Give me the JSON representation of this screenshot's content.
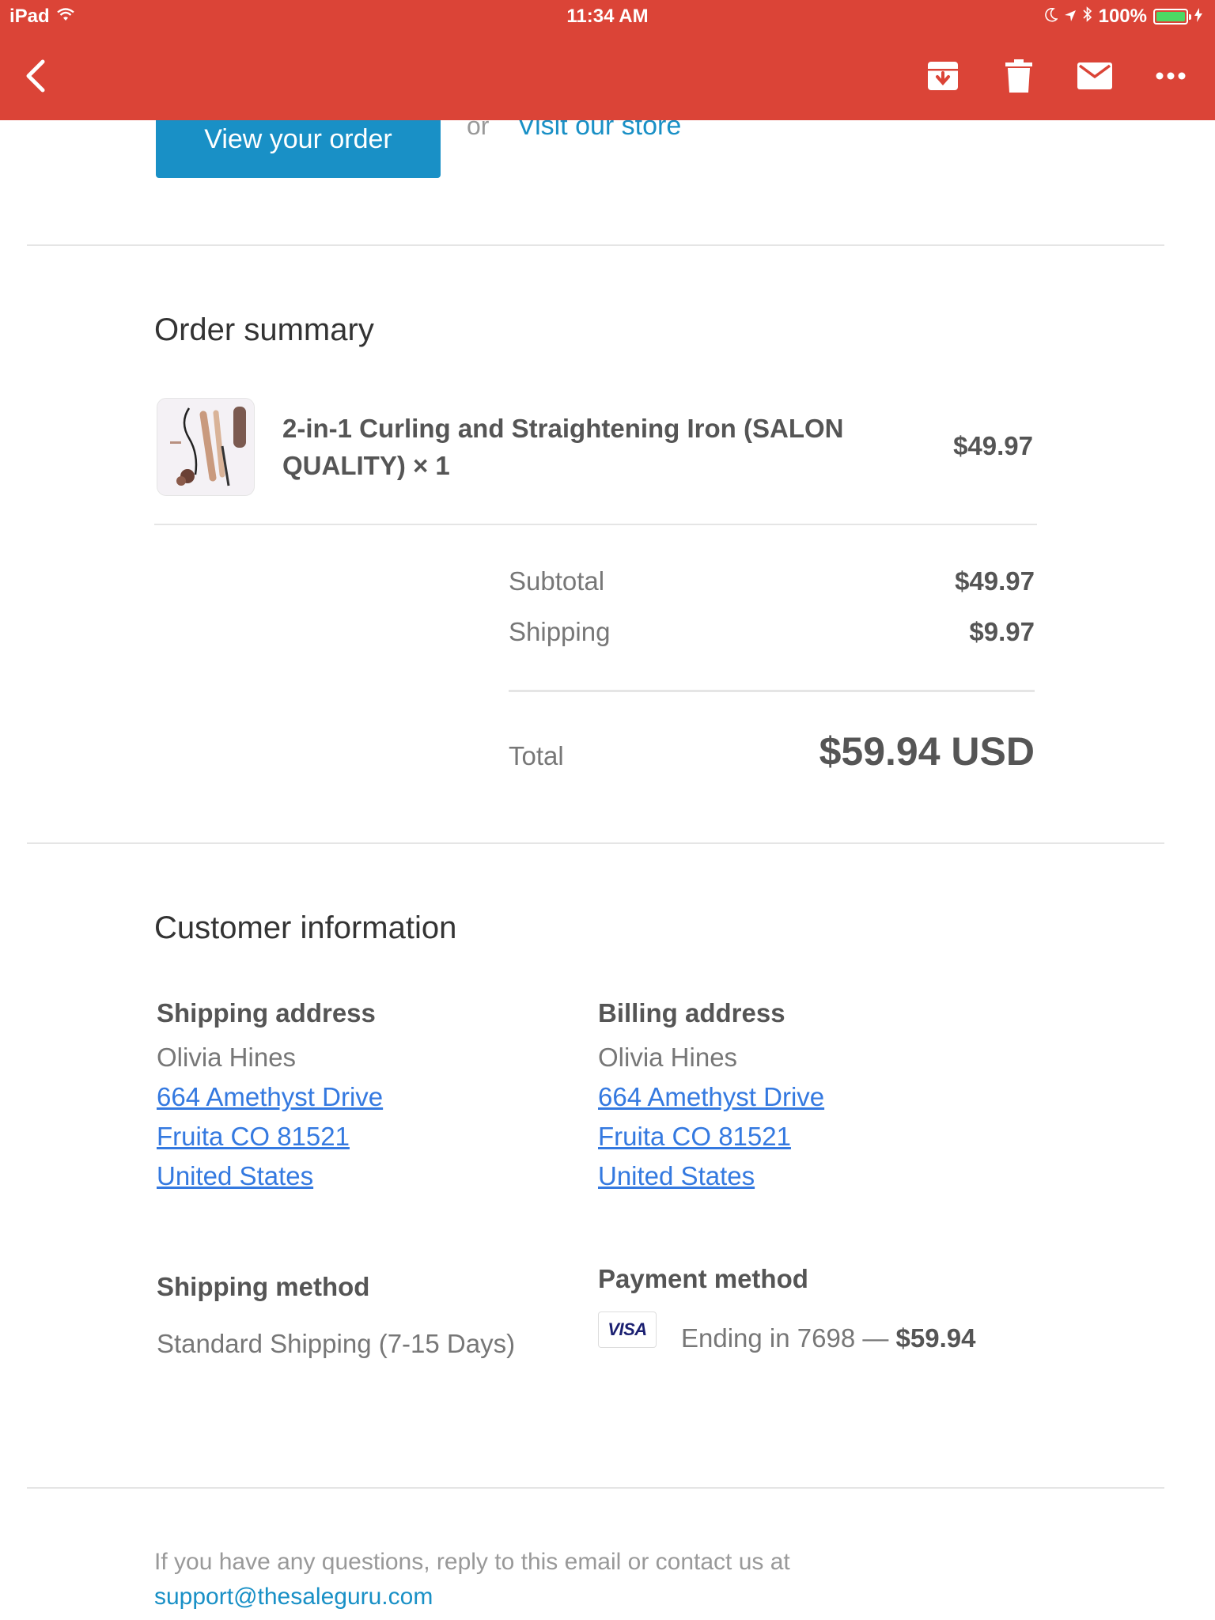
{
  "status_bar": {
    "device": "iPad",
    "time": "11:34 AM",
    "battery": "100%"
  },
  "toolbar": {
    "back_icon": "chevron-left-icon",
    "actions": [
      "archive-icon",
      "trash-icon",
      "mail-icon",
      "more-icon"
    ]
  },
  "cta": {
    "view_order": "View your order",
    "or": "or",
    "visit_store": "Visit our store"
  },
  "order_summary": {
    "heading": "Order summary",
    "item": {
      "title": "2-in-1 Curling and Straightening Iron (SALON QUALITY) × 1",
      "price": "$49.97"
    },
    "subtotal_label": "Subtotal",
    "subtotal_value": "$49.97",
    "shipping_label": "Shipping",
    "shipping_value": "$9.97",
    "total_label": "Total",
    "total_value": "$59.94 USD"
  },
  "customer_info": {
    "heading": "Customer information",
    "shipping_address": {
      "title": "Shipping address",
      "name": "Olivia Hines",
      "line1": "664 Amethyst Drive",
      "line2": "Fruita CO 81521",
      "country": "United States"
    },
    "billing_address": {
      "title": "Billing address",
      "name": "Olivia Hines",
      "line1": "664 Amethyst Drive",
      "line2": "Fruita CO 81521",
      "country": "United States"
    },
    "shipping_method": {
      "title": "Shipping method",
      "value": "Standard Shipping (7-15 Days)"
    },
    "payment_method": {
      "title": "Payment method",
      "card_brand": "VISA",
      "ending": "Ending in 7698 —",
      "amount": "$59.94"
    }
  },
  "footer": {
    "text": "If you have any questions, reply to this email or contact us at",
    "email": "support@thesaleguru.com"
  },
  "colors": {
    "app_bar": "#db4437",
    "accent_button": "#1990c6",
    "link": "#3479e0"
  }
}
